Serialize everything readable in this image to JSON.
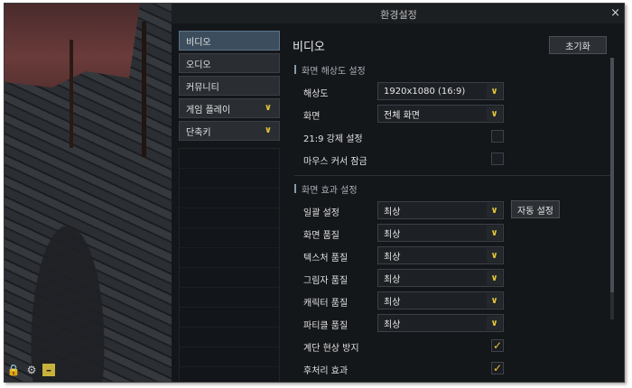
{
  "window": {
    "title": "환경설정",
    "close_icon": "×"
  },
  "nav": {
    "items": [
      {
        "label": "비디오",
        "active": true,
        "chevron": ""
      },
      {
        "label": "오디오",
        "active": false,
        "chevron": ""
      },
      {
        "label": "커뮤니티",
        "active": false,
        "chevron": ""
      },
      {
        "label": "게임 플레이",
        "active": false,
        "chevron": "∨"
      },
      {
        "label": "단축키",
        "active": false,
        "chevron": "∨"
      }
    ]
  },
  "content": {
    "title": "비디오",
    "reset_label": "초기화",
    "resolution_section": {
      "heading": "화면 해상도 설정",
      "rows": {
        "resolution": {
          "label": "해상도",
          "value": "1920x1080 (16:9)"
        },
        "screen": {
          "label": "화면",
          "value": "전체 화면"
        },
        "force_219": {
          "label": "21:9 강제 설정",
          "checked": false
        },
        "mouse_lock": {
          "label": "마우스 커서 잠금",
          "checked": false
        }
      }
    },
    "effects_section": {
      "heading": "화면 효과 설정",
      "auto_label": "자동 설정",
      "rows": {
        "batch": {
          "label": "일괄 설정",
          "value": "최상"
        },
        "screen_quality": {
          "label": "화면 품질",
          "value": "최상"
        },
        "texture_quality": {
          "label": "텍스처 품질",
          "value": "최상"
        },
        "shadow_quality": {
          "label": "그림자 품질",
          "value": "최상"
        },
        "character_quality": {
          "label": "캐릭터 품질",
          "value": "최상"
        },
        "particle_quality": {
          "label": "파티클 품질",
          "value": "최상"
        },
        "anti_banding": {
          "label": "계단 현상 방지",
          "checked": true
        },
        "post_process": {
          "label": "후처리 효과",
          "checked": true
        }
      }
    }
  },
  "icons": {
    "dropdown_arrow": "∨",
    "check_mark": "✓",
    "lock_icon": "🔒",
    "gear_icon": "⚙",
    "minus_icon": "–"
  }
}
